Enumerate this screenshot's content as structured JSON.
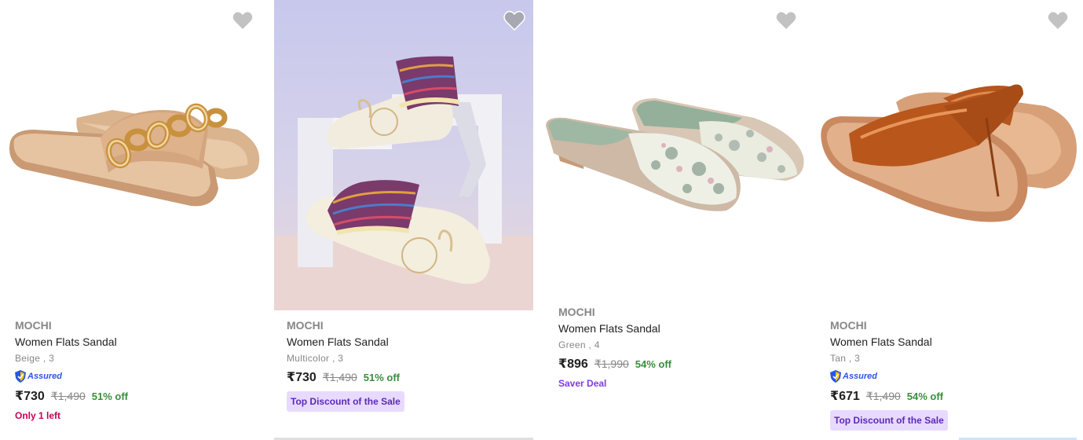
{
  "products": [
    {
      "brand": "MOCHI",
      "title": "Women Flats Sandal",
      "variant": "Beige , 3",
      "assured": "Assured",
      "price": "₹730",
      "mrp": "₹1,490",
      "discount": "51% off",
      "tag": "Only 1 left",
      "wishlist_icon": "heart-icon"
    },
    {
      "brand": "MOCHI",
      "title": "Women Flats Sandal",
      "variant": "Multicolor , 3",
      "price": "₹730",
      "mrp": "₹1,490",
      "discount": "51% off",
      "tag": "Top Discount of the Sale",
      "wishlist_icon": "heart-icon"
    },
    {
      "brand": "MOCHI",
      "title": "Women Flats Sandal",
      "variant": "Green , 4",
      "price": "₹896",
      "mrp": "₹1,990",
      "discount": "54% off",
      "tag": "Saver Deal",
      "wishlist_icon": "heart-icon"
    },
    {
      "brand": "MOCHI",
      "title": "Women Flats Sandal",
      "variant": "Tan , 3",
      "assured": "Assured",
      "price": "₹671",
      "mrp": "₹1,490",
      "discount": "54% off",
      "tag": "Top Discount of the Sale",
      "wishlist_icon": "heart-icon"
    }
  ],
  "colors": {
    "price_green": "#388e3c",
    "assured_blue": "#2a55e5",
    "tag_red": "#c70055",
    "tag_purple": "#7e3ce0",
    "tag_box_bg": "#e8daff",
    "muted": "#878787"
  }
}
